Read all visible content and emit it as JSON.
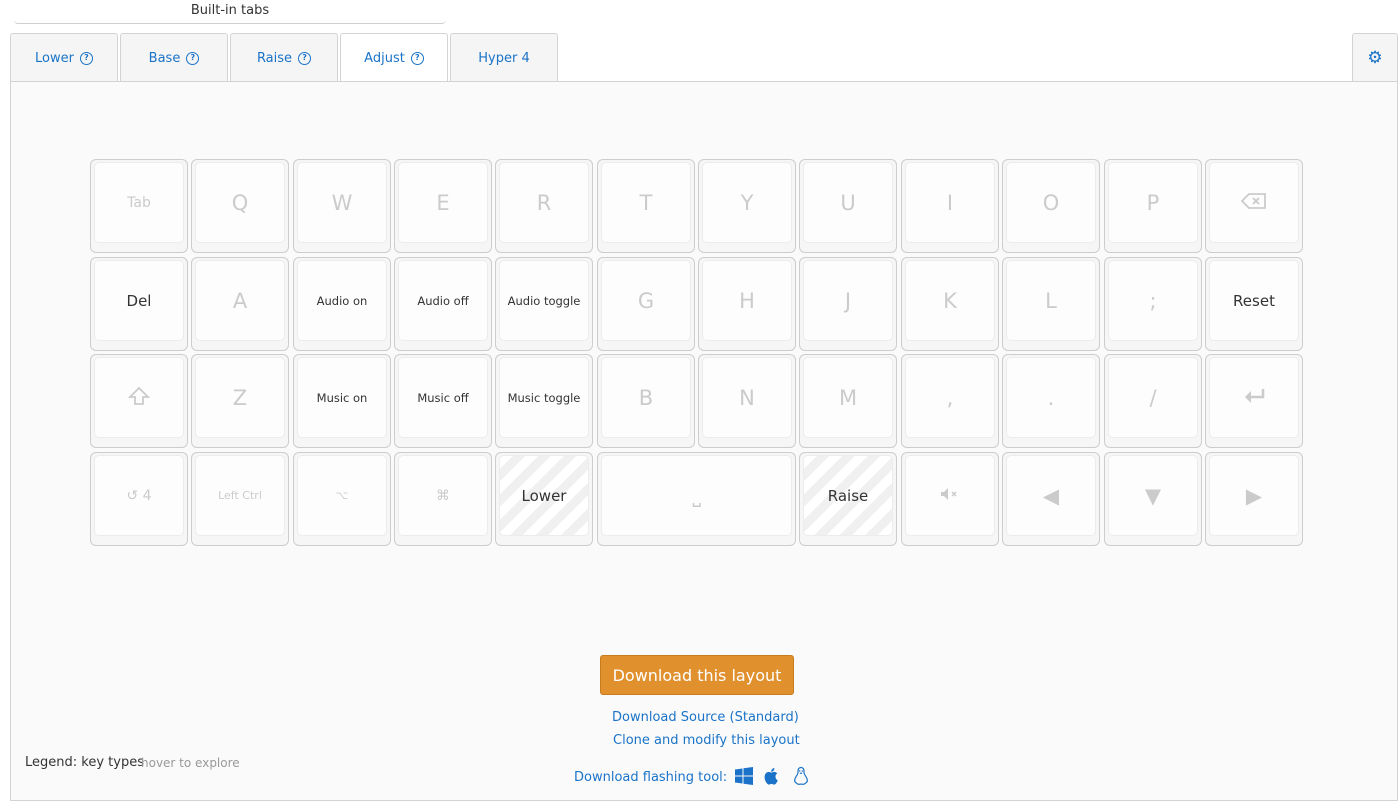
{
  "header": {
    "builtin_tabs_label": "Built-in tabs"
  },
  "tabs": [
    {
      "label": "Lower",
      "help": "?"
    },
    {
      "label": "Base",
      "help": "?"
    },
    {
      "label": "Raise",
      "help": "?"
    },
    {
      "label": "Adjust",
      "help": "?",
      "active": true
    },
    {
      "label": "Hyper 4"
    }
  ],
  "keyboard": {
    "rows": [
      [
        {
          "label": "Tab",
          "style": "faded-sm"
        },
        {
          "label": "Q",
          "style": "faded"
        },
        {
          "label": "W",
          "style": "faded"
        },
        {
          "label": "E",
          "style": "faded"
        },
        {
          "label": "R",
          "style": "faded"
        },
        {
          "label": "T",
          "style": "faded"
        },
        {
          "label": "Y",
          "style": "faded"
        },
        {
          "label": "U",
          "style": "faded"
        },
        {
          "label": "I",
          "style": "faded"
        },
        {
          "label": "O",
          "style": "faded"
        },
        {
          "label": "P",
          "style": "faded"
        },
        {
          "label": "",
          "icon": "backspace-icon",
          "style": "faded"
        }
      ],
      [
        {
          "label": "Del",
          "style": "dark-md"
        },
        {
          "label": "A",
          "style": "faded"
        },
        {
          "label": "Audio on",
          "style": "dark-sm"
        },
        {
          "label": "Audio off",
          "style": "dark-sm"
        },
        {
          "label": "Audio toggle",
          "style": "dark-sm"
        },
        {
          "label": "G",
          "style": "faded"
        },
        {
          "label": "H",
          "style": "faded"
        },
        {
          "label": "J",
          "style": "faded"
        },
        {
          "label": "K",
          "style": "faded"
        },
        {
          "label": "L",
          "style": "faded"
        },
        {
          "label": ";",
          "style": "faded"
        },
        {
          "label": "Reset",
          "style": "dark-md"
        }
      ],
      [
        {
          "label": "",
          "icon": "shift-icon",
          "style": "faded"
        },
        {
          "label": "Z",
          "style": "faded"
        },
        {
          "label": "Music on",
          "style": "dark-sm"
        },
        {
          "label": "Music off",
          "style": "dark-sm"
        },
        {
          "label": "Music toggle",
          "style": "dark-sm"
        },
        {
          "label": "B",
          "style": "faded"
        },
        {
          "label": "N",
          "style": "faded"
        },
        {
          "label": "M",
          "style": "faded"
        },
        {
          "label": ",",
          "style": "faded"
        },
        {
          "label": ".",
          "style": "faded"
        },
        {
          "label": "/",
          "style": "faded"
        },
        {
          "label": "",
          "icon": "enter-icon",
          "style": "faded"
        }
      ],
      [
        {
          "label": "↺ 4",
          "style": "faded-sm"
        },
        {
          "label": "Left Ctrl",
          "style": "faded-xs"
        },
        {
          "label": "⌥",
          "style": "faded-xs"
        },
        {
          "label": "⌘",
          "style": "faded-sm"
        },
        {
          "label": "Lower",
          "style": "dark-md",
          "striped": true
        },
        {
          "label": "⎵",
          "style": "faded",
          "wide": true
        },
        {
          "label": "Raise",
          "style": "dark-md",
          "striped": true
        },
        {
          "label": "",
          "icon": "mute-icon",
          "style": "faded"
        },
        {
          "label": "◀",
          "style": "faded"
        },
        {
          "label": "▼",
          "style": "faded"
        },
        {
          "label": "▶",
          "style": "faded"
        }
      ]
    ]
  },
  "actions": {
    "download_button": "Download this layout",
    "download_source": "Download Source (Standard)",
    "clone": "Clone and modify this layout"
  },
  "legend": {
    "label": "Legend: key types",
    "hint": "hover to explore"
  },
  "flashing": {
    "label": "Download flashing tool:",
    "platforms": [
      "windows-icon",
      "apple-icon",
      "linux-icon"
    ]
  },
  "colors": {
    "accent": "#1a73c8",
    "download_button": "#e0912e"
  }
}
